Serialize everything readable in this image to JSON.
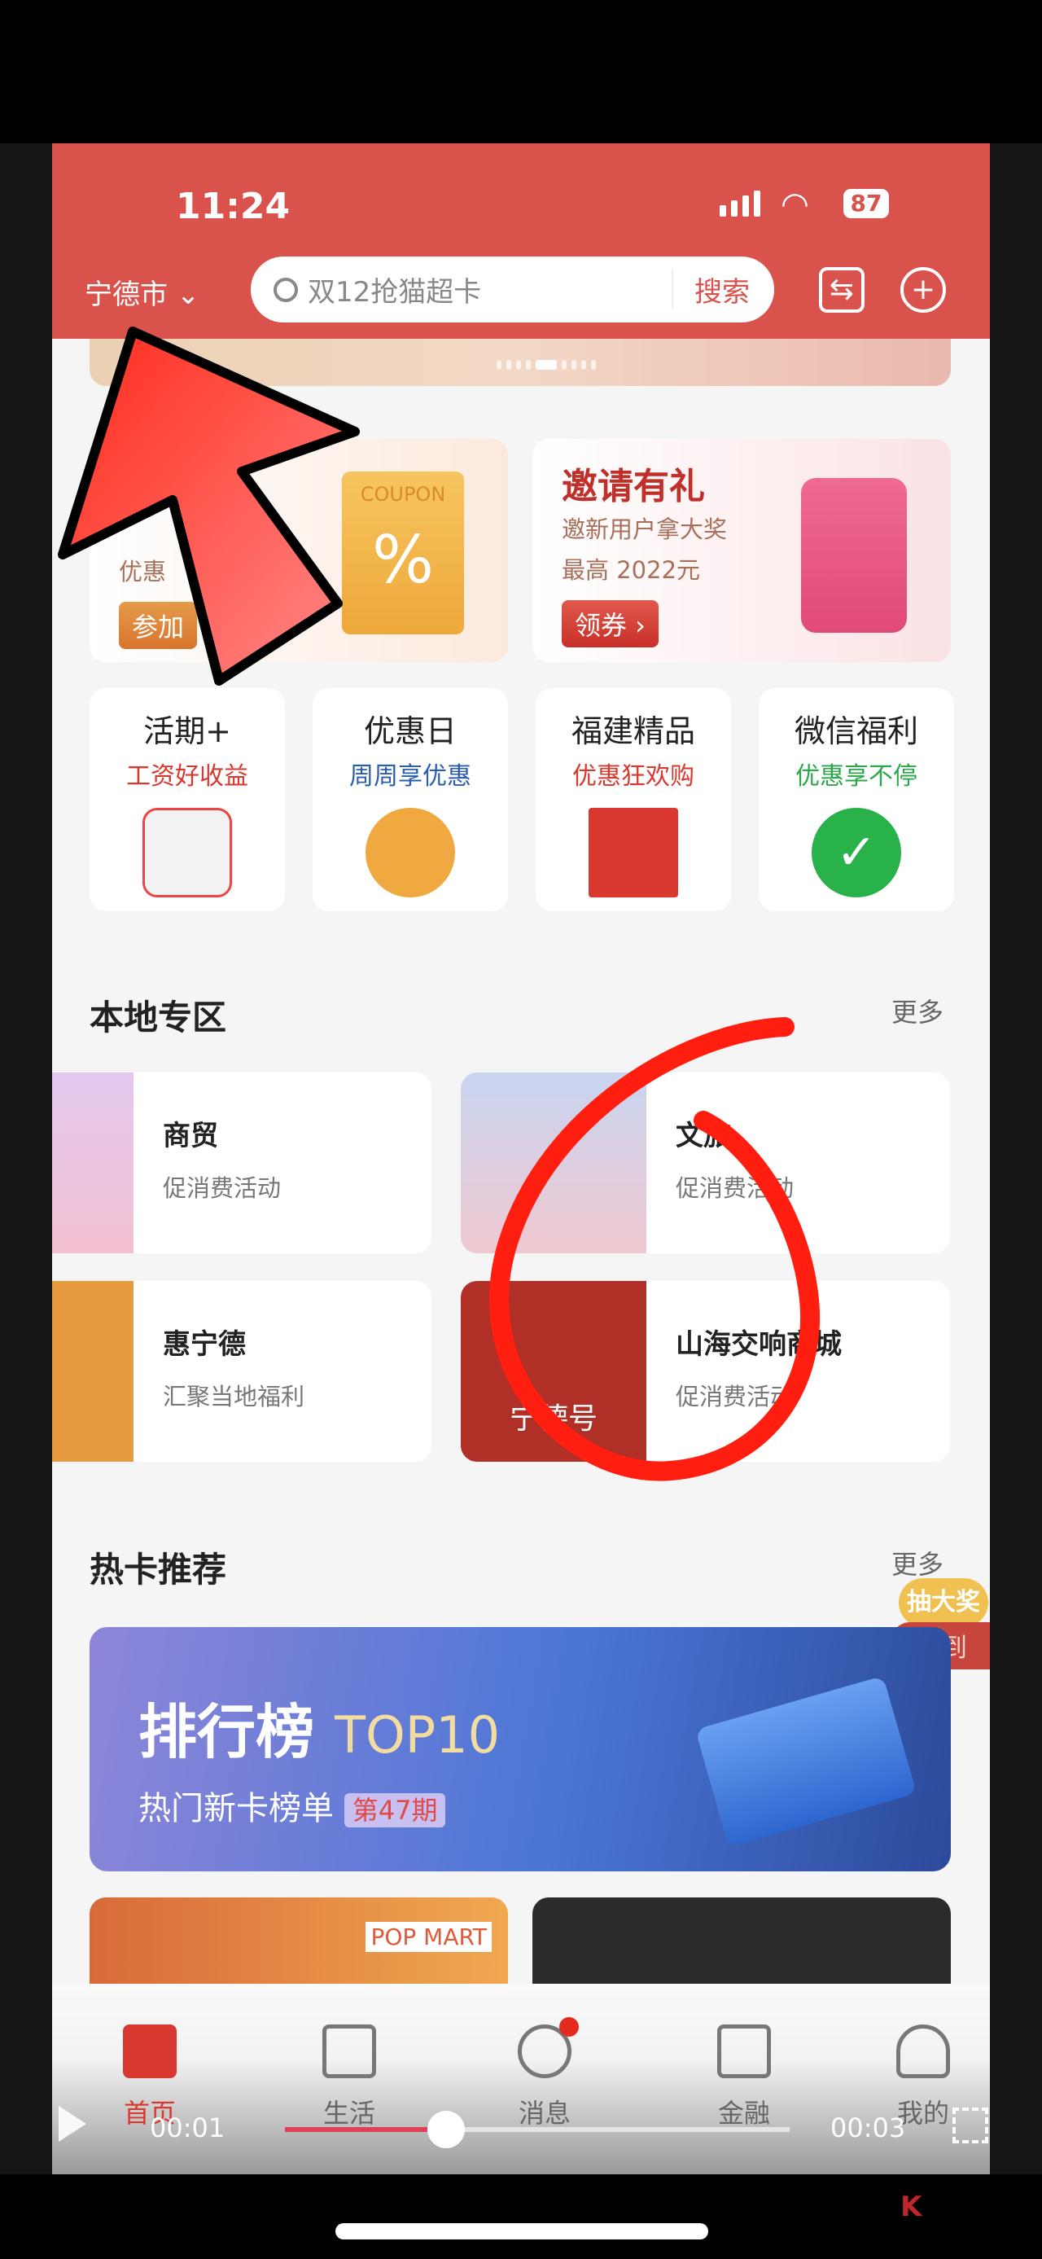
{
  "status_bar": {
    "time": "11:24",
    "battery": "87"
  },
  "header": {
    "city": "宁德市",
    "search_placeholder": "双12抢猫超卡",
    "search_button": "搜索"
  },
  "promos": [
    {
      "title": "",
      "subtitle": "优惠",
      "button": "参加",
      "art": "COUPON"
    },
    {
      "title": "邀请有礼",
      "subtitle": "邀新用户拿大奖",
      "line2": "最高 2022元",
      "button": "领券 ›"
    }
  ],
  "quick_entries": [
    {
      "title": "活期+",
      "subtitle": "工资好收益",
      "color": "#d9382e"
    },
    {
      "title": "优惠日",
      "subtitle": "周周享优惠",
      "color": "#2a5db0"
    },
    {
      "title": "福建精品",
      "subtitle": "优惠狂欢购",
      "color": "#d9382e"
    },
    {
      "title": "微信福利",
      "subtitle": "优惠享不停",
      "color": "#2aa84a"
    }
  ],
  "local_section": {
    "title": "本地专区",
    "more": "更多",
    "items": [
      {
        "title": "商贸",
        "subtitle": "促消费活动"
      },
      {
        "title": "文旅",
        "subtitle": "促消费活动"
      },
      {
        "title": "惠宁德",
        "subtitle": "汇聚当地福利"
      },
      {
        "title": "山海交响商城",
        "subtitle": "促消费活动",
        "logo": "宁德号"
      }
    ]
  },
  "hot_cards": {
    "title": "热卡推荐",
    "more": "更多",
    "banner_title": "排行榜",
    "banner_top": "TOP10",
    "banner_sub": "热门新卡榜单",
    "banner_badge": "第47期",
    "float_top": "抽大奖",
    "float_bottom": "签到",
    "card2_brand": "POP MART"
  },
  "tabs": [
    {
      "label": "首页",
      "active": true
    },
    {
      "label": "生活"
    },
    {
      "label": "消息",
      "badge": true
    },
    {
      "label": "金融"
    },
    {
      "label": "我的"
    }
  ],
  "video": {
    "current": "00:01",
    "total": "00:03",
    "progress": 0.32
  },
  "colors": {
    "header": "#d9534c",
    "accent": "#d9382e",
    "annotation": "#ff2a1a"
  }
}
